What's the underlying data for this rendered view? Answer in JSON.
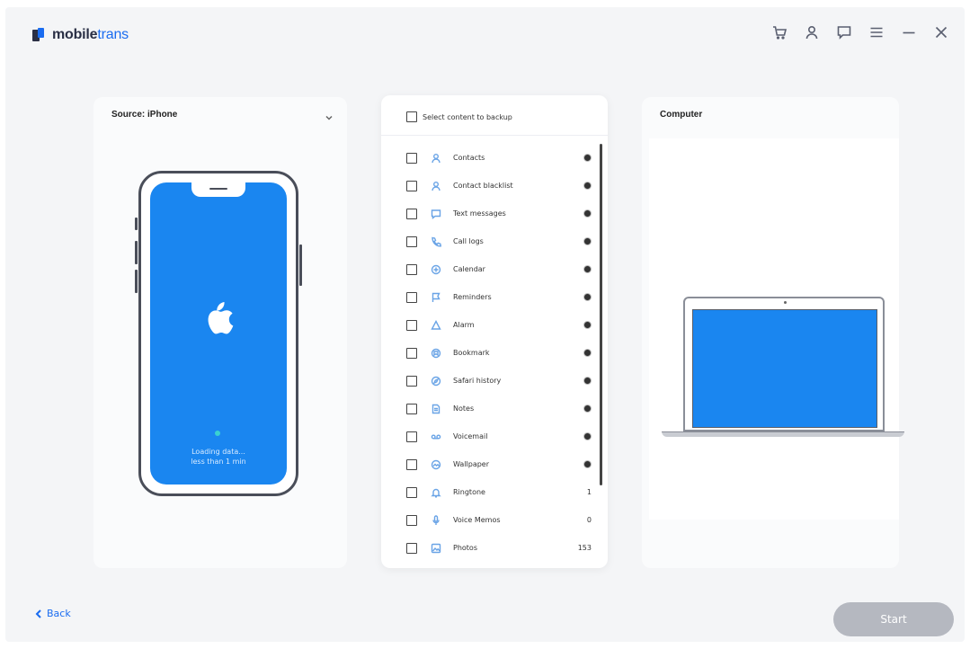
{
  "app": {
    "brand_bold": "mobile",
    "brand_accent": "trans",
    "accent_color": "#1a6cf0"
  },
  "window_controls": [
    {
      "name": "cart-icon"
    },
    {
      "name": "account-icon"
    },
    {
      "name": "feedback-icon"
    },
    {
      "name": "menu-icon"
    },
    {
      "name": "minimize-icon"
    },
    {
      "name": "close-icon"
    }
  ],
  "source": {
    "title": "Source: iPhone",
    "loading_text_line1": "Loading data...",
    "loading_text_line2": "less than 1 min"
  },
  "content_list": {
    "select_all_label": "Select content to backup",
    "items": [
      {
        "label": "Contacts",
        "icon": "contact-icon",
        "status": "loading"
      },
      {
        "label": "Contact blacklist",
        "icon": "contact-blacklist-icon",
        "status": "loading"
      },
      {
        "label": "Text messages",
        "icon": "message-icon",
        "status": "loading"
      },
      {
        "label": "Call logs",
        "icon": "phone-icon",
        "status": "loading"
      },
      {
        "label": "Calendar",
        "icon": "calendar-icon",
        "status": "loading"
      },
      {
        "label": "Reminders",
        "icon": "flag-icon",
        "status": "loading"
      },
      {
        "label": "Alarm",
        "icon": "alarm-icon",
        "status": "loading"
      },
      {
        "label": "Bookmark",
        "icon": "bookmark-icon",
        "status": "loading"
      },
      {
        "label": "Safari history",
        "icon": "safari-icon",
        "status": "loading"
      },
      {
        "label": "Notes",
        "icon": "note-icon",
        "status": "loading"
      },
      {
        "label": "Voicemail",
        "icon": "voicemail-icon",
        "status": "loading"
      },
      {
        "label": "Wallpaper",
        "icon": "wallpaper-icon",
        "status": "loading"
      },
      {
        "label": "Ringtone",
        "icon": "bell-icon",
        "count": "1"
      },
      {
        "label": "Voice Memos",
        "icon": "microphone-icon",
        "count": "0"
      },
      {
        "label": "Photos",
        "icon": "photo-icon",
        "count": "153"
      }
    ]
  },
  "destination": {
    "title": "Computer"
  },
  "footer": {
    "back_label": "Back",
    "start_label": "Start"
  }
}
